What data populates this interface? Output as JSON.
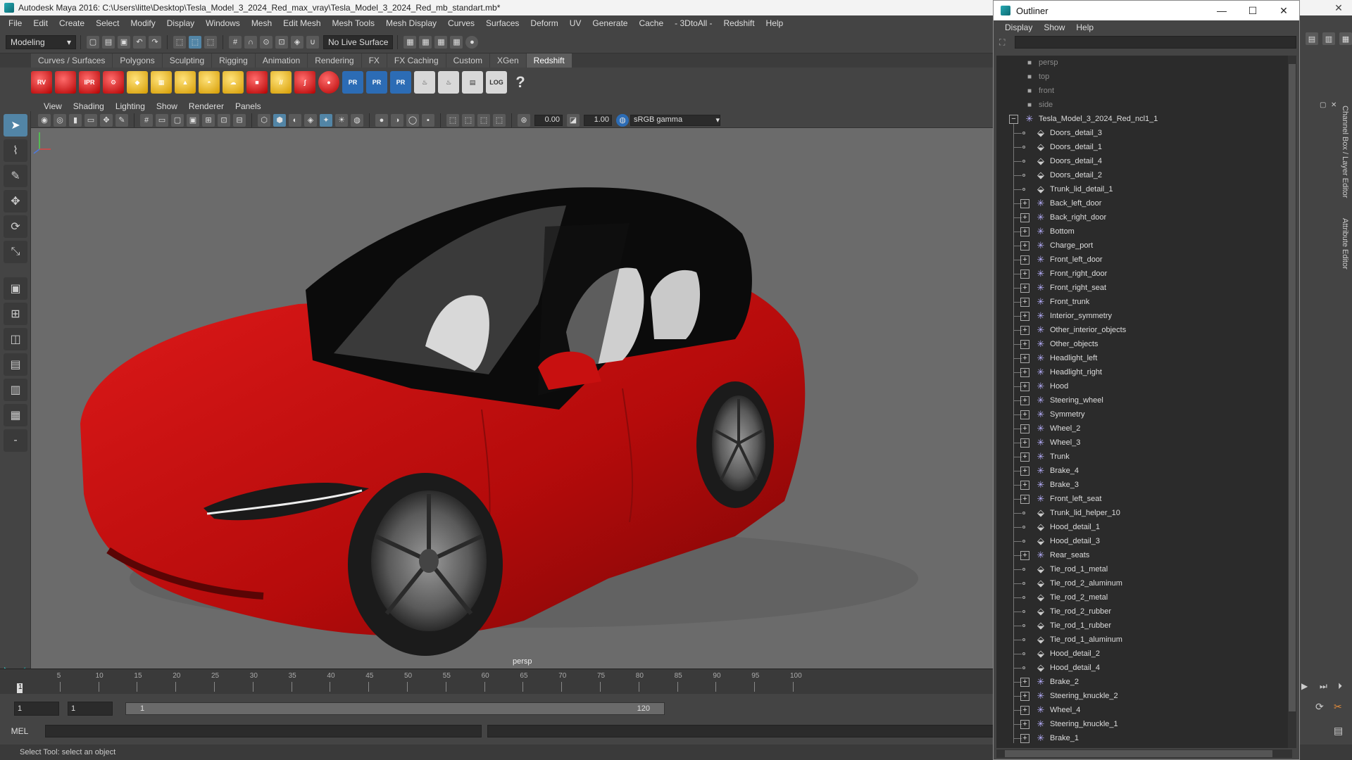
{
  "window": {
    "title": "Autodesk Maya 2016: C:\\Users\\litte\\Desktop\\Tesla_Model_3_2024_Red_max_vray\\Tesla_Model_3_2024_Red_mb_standart.mb*"
  },
  "menubar": [
    "File",
    "Edit",
    "Create",
    "Select",
    "Modify",
    "Display",
    "Windows",
    "Mesh",
    "Edit Mesh",
    "Mesh Tools",
    "Mesh Display",
    "Curves",
    "Surfaces",
    "Deform",
    "UV",
    "Generate",
    "Cache",
    "- 3DtoAll -",
    "Redshift",
    "Help"
  ],
  "statusline": {
    "mode": "Modeling",
    "live_surface": "No Live Surface"
  },
  "shelf": {
    "tabs": [
      "Curves / Surfaces",
      "Polygons",
      "Sculpting",
      "Rigging",
      "Animation",
      "Rendering",
      "FX",
      "FX Caching",
      "Custom",
      "XGen",
      "Redshift"
    ],
    "active_tab": "Redshift",
    "buttons": {
      "rv": "RV",
      "ipr": "IPR",
      "pr": "PR",
      "log": "LOG",
      "help": "?"
    }
  },
  "panel": {
    "menu": [
      "View",
      "Shading",
      "Lighting",
      "Show",
      "Renderer",
      "Panels"
    ],
    "exposure": "0.00",
    "gamma_value": "1.00",
    "color_space": "sRGB gamma",
    "camera_label": "persp"
  },
  "timeline": {
    "ticks": [
      "5",
      "10",
      "15",
      "20",
      "25",
      "30",
      "35",
      "40",
      "45",
      "50",
      "55",
      "60",
      "65",
      "70",
      "75",
      "80",
      "85",
      "90",
      "95",
      "100"
    ],
    "current": "1"
  },
  "range": {
    "start": "1",
    "playback_start": "1",
    "slider_left": "1",
    "slider_right": "120"
  },
  "cmdline": {
    "label": "MEL"
  },
  "helpline": "Select Tool: select an object",
  "side_tabs": {
    "channel_box": "Channel Box / Layer Editor",
    "attribute_editor": "Attribute Editor"
  },
  "outliner": {
    "title": "Outliner",
    "menu": [
      "Display",
      "Show",
      "Help"
    ],
    "cameras": [
      "persp",
      "top",
      "front",
      "side"
    ],
    "root": "Tesla_Model_3_2024_Red_ncl1_1",
    "children": [
      {
        "name": "Doors_detail_3",
        "group": false
      },
      {
        "name": "Doors_detail_1",
        "group": false
      },
      {
        "name": "Doors_detail_4",
        "group": false
      },
      {
        "name": "Doors_detail_2",
        "group": false
      },
      {
        "name": "Trunk_lid_detail_1",
        "group": false
      },
      {
        "name": "Back_left_door",
        "group": true
      },
      {
        "name": "Back_right_door",
        "group": true
      },
      {
        "name": "Bottom",
        "group": true
      },
      {
        "name": "Charge_port",
        "group": true
      },
      {
        "name": "Front_left_door",
        "group": true
      },
      {
        "name": "Front_right_door",
        "group": true
      },
      {
        "name": "Front_right_seat",
        "group": true
      },
      {
        "name": "Front_trunk",
        "group": true
      },
      {
        "name": "Interior_symmetry",
        "group": true
      },
      {
        "name": "Other_interior_objects",
        "group": true
      },
      {
        "name": "Other_objects",
        "group": true
      },
      {
        "name": "Headlight_left",
        "group": true
      },
      {
        "name": "Headlight_right",
        "group": true
      },
      {
        "name": "Hood",
        "group": true
      },
      {
        "name": "Steering_wheel",
        "group": true
      },
      {
        "name": "Symmetry",
        "group": true
      },
      {
        "name": "Wheel_2",
        "group": true
      },
      {
        "name": "Wheel_3",
        "group": true
      },
      {
        "name": "Trunk",
        "group": true
      },
      {
        "name": "Brake_4",
        "group": true
      },
      {
        "name": "Brake_3",
        "group": true
      },
      {
        "name": "Front_left_seat",
        "group": true
      },
      {
        "name": "Trunk_lid_helper_10",
        "group": false
      },
      {
        "name": "Hood_detail_1",
        "group": false
      },
      {
        "name": "Hood_detail_3",
        "group": false
      },
      {
        "name": "Rear_seats",
        "group": true
      },
      {
        "name": "Tie_rod_1_metal",
        "group": false
      },
      {
        "name": "Tie_rod_2_aluminum",
        "group": false
      },
      {
        "name": "Tie_rod_2_metal",
        "group": false
      },
      {
        "name": "Tie_rod_2_rubber",
        "group": false
      },
      {
        "name": "Tie_rod_1_rubber",
        "group": false
      },
      {
        "name": "Tie_rod_1_aluminum",
        "group": false
      },
      {
        "name": "Hood_detail_2",
        "group": false
      },
      {
        "name": "Hood_detail_4",
        "group": false
      },
      {
        "name": "Brake_2",
        "group": true
      },
      {
        "name": "Steering_knuckle_2",
        "group": true
      },
      {
        "name": "Wheel_4",
        "group": true
      },
      {
        "name": "Steering_knuckle_1",
        "group": true
      },
      {
        "name": "Brake_1",
        "group": true
      }
    ]
  },
  "colors": {
    "car_body": "#c40d0d",
    "viewport_bg": "#6b6b6b",
    "active_tool": "#5285a6",
    "outliner_transform_icon": "#b8b0ff"
  }
}
